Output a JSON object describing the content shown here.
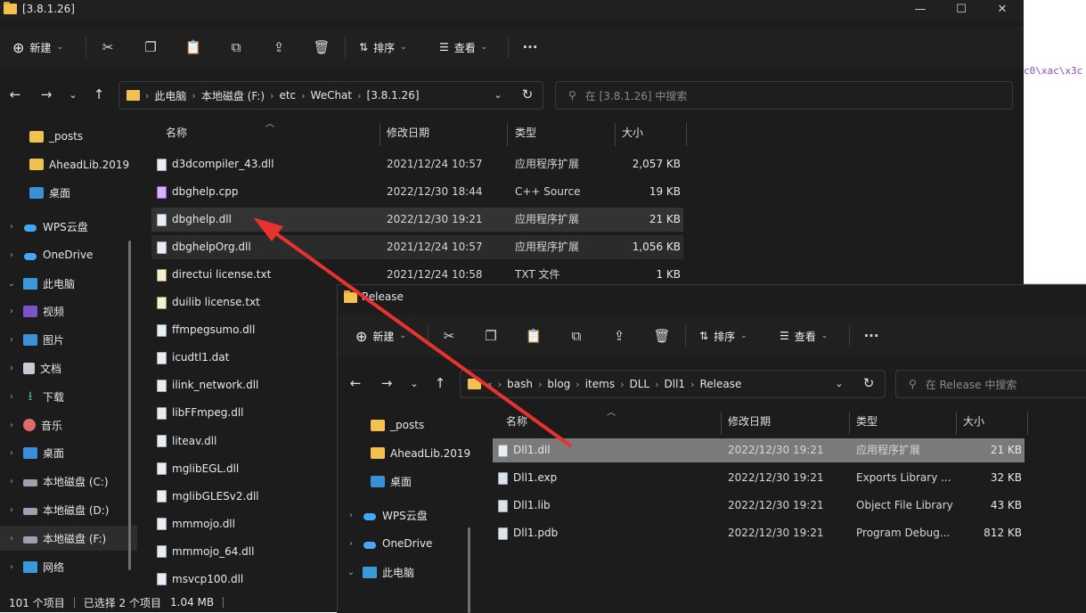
{
  "background": {
    "code_text": "c0\\xac\\x3c"
  },
  "win1": {
    "title": "[3.8.1.26]",
    "controls": {
      "min": "—",
      "max": "☐",
      "close": "✕"
    },
    "toolbar": {
      "new_label": "新建",
      "sort_label": "排序",
      "view_label": "查看",
      "more": "···"
    },
    "address": [
      "此电脑",
      "本地磁盘 (F:)",
      "etc",
      "WeChat",
      "[3.8.1.26]"
    ],
    "search_placeholder": "在 [3.8.1.26] 中搜索",
    "sidebar": [
      {
        "label": "_posts",
        "icon": "folder"
      },
      {
        "label": "AheadLib.2019",
        "icon": "folder"
      },
      {
        "label": "桌面",
        "icon": "desktop"
      },
      {
        "label": "WPS云盘",
        "icon": "cloud-wps",
        "chevron": "›"
      },
      {
        "label": "OneDrive",
        "icon": "cloud",
        "chevron": "›"
      },
      {
        "label": "此电脑",
        "icon": "pc",
        "chevron": "⌄"
      },
      {
        "label": "视频",
        "icon": "video",
        "chevron": "›"
      },
      {
        "label": "图片",
        "icon": "pic",
        "chevron": "›"
      },
      {
        "label": "文档",
        "icon": "doc",
        "chevron": "›"
      },
      {
        "label": "下载",
        "icon": "dl",
        "chevron": "›"
      },
      {
        "label": "音乐",
        "icon": "music",
        "chevron": "›"
      },
      {
        "label": "桌面",
        "icon": "desktop",
        "chevron": "›"
      },
      {
        "label": "本地磁盘 (C:)",
        "icon": "drive",
        "chevron": "›"
      },
      {
        "label": "本地磁盘 (D:)",
        "icon": "drive",
        "chevron": "›"
      },
      {
        "label": "本地磁盘 (F:)",
        "icon": "drive",
        "chevron": "›"
      },
      {
        "label": "网络",
        "icon": "pc",
        "chevron": "›"
      }
    ],
    "columns": {
      "name": "名称",
      "date": "修改日期",
      "type": "类型",
      "size": "大小"
    },
    "files": [
      {
        "name": "d3dcompiler_43.dll",
        "date": "2021/12/24 10:57",
        "type": "应用程序扩展",
        "size": "2,057 KB",
        "icon": "dll"
      },
      {
        "name": "dbghelp.cpp",
        "date": "2022/12/30 18:44",
        "type": "C++ Source",
        "size": "19 KB",
        "icon": "cpp"
      },
      {
        "name": "dbghelp.dll",
        "date": "2022/12/30 19:21",
        "type": "应用程序扩展",
        "size": "21 KB",
        "icon": "dll"
      },
      {
        "name": "dbghelpOrg.dll",
        "date": "2021/12/24 10:57",
        "type": "应用程序扩展",
        "size": "1,056 KB",
        "icon": "dll"
      },
      {
        "name": "directui license.txt",
        "date": "2021/12/24 10:58",
        "type": "TXT 文件",
        "size": "1 KB",
        "icon": "txt"
      },
      {
        "name": "duilib license.txt",
        "date": "",
        "type": "",
        "size": "",
        "icon": "txt"
      },
      {
        "name": "ffmpegsumo.dll",
        "date": "",
        "type": "",
        "size": "",
        "icon": "dll"
      },
      {
        "name": "icudtl1.dat",
        "date": "",
        "type": "",
        "size": "",
        "icon": "dll"
      },
      {
        "name": "ilink_network.dll",
        "date": "",
        "type": "",
        "size": "",
        "icon": "dll"
      },
      {
        "name": "libFFmpeg.dll",
        "date": "",
        "type": "",
        "size": "",
        "icon": "dll"
      },
      {
        "name": "liteav.dll",
        "date": "",
        "type": "",
        "size": "",
        "icon": "dll"
      },
      {
        "name": "mglibEGL.dll",
        "date": "",
        "type": "",
        "size": "",
        "icon": "dll"
      },
      {
        "name": "mglibGLESv2.dll",
        "date": "",
        "type": "",
        "size": "",
        "icon": "dll"
      },
      {
        "name": "mmmojo.dll",
        "date": "",
        "type": "",
        "size": "",
        "icon": "dll"
      },
      {
        "name": "mmmojo_64.dll",
        "date": "",
        "type": "",
        "size": "",
        "icon": "dll"
      },
      {
        "name": "msvcp100.dll",
        "date": "",
        "type": "",
        "size": "",
        "icon": "dll"
      }
    ],
    "status": {
      "count": "101 个项目",
      "selected": "已选择 2 个项目",
      "size": "1.04 MB"
    }
  },
  "win2": {
    "title": "Release",
    "toolbar": {
      "new_label": "新建",
      "sort_label": "排序",
      "view_label": "查看",
      "more": "···"
    },
    "address": [
      "bash",
      "blog",
      "items",
      "DLL",
      "Dll1",
      "Release"
    ],
    "address_overflow": "«",
    "search_placeholder": "在 Release 中搜索",
    "sidebar": [
      {
        "label": "_posts",
        "icon": "folder"
      },
      {
        "label": "AheadLib.2019",
        "icon": "folder"
      },
      {
        "label": "桌面",
        "icon": "desktop"
      },
      {
        "label": "WPS云盘",
        "icon": "cloud-wps",
        "chevron": "›"
      },
      {
        "label": "OneDrive",
        "icon": "cloud",
        "chevron": "›"
      },
      {
        "label": "此电脑",
        "icon": "pc",
        "chevron": "⌄"
      }
    ],
    "columns": {
      "name": "名称",
      "date": "修改日期",
      "type": "类型",
      "size": "大小"
    },
    "files": [
      {
        "name": "Dll1.dll",
        "date": "2022/12/30 19:21",
        "type": "应用程序扩展",
        "size": "21 KB",
        "icon": "dll"
      },
      {
        "name": "Dll1.exp",
        "date": "2022/12/30 19:21",
        "type": "Exports Library ...",
        "size": "32 KB",
        "icon": "exp"
      },
      {
        "name": "Dll1.lib",
        "date": "2022/12/30 19:21",
        "type": "Object File Library",
        "size": "43 KB",
        "icon": "exp"
      },
      {
        "name": "Dll1.pdb",
        "date": "2022/12/30 19:21",
        "type": "Program Debug...",
        "size": "812 KB",
        "icon": "exp"
      }
    ]
  },
  "annotation": {
    "arrow_color": "#e8322e"
  }
}
